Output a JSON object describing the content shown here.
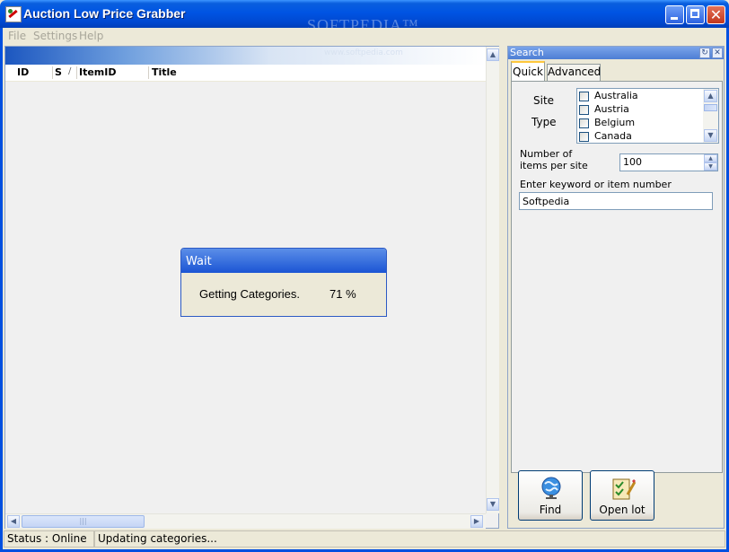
{
  "window": {
    "title": "Auction Low Price Grabber",
    "watermark": "SOFTPEDIA™"
  },
  "menu": [
    "File",
    "Settings",
    "Help"
  ],
  "list": {
    "watermark": "www.softpedia.com",
    "columns": [
      "ID",
      "S",
      "/",
      "ItemID",
      "Title"
    ],
    "hscroll_grip": "|||"
  },
  "wait_dialog": {
    "title": "Wait",
    "message": "Getting Categories.",
    "progress": "71 %"
  },
  "search": {
    "title": "Search",
    "tabs": [
      "Quick",
      "Advanced"
    ],
    "site_label": "Site",
    "type_label": "Type",
    "sites": [
      "Australia",
      "Austria",
      "Belgium",
      "Canada"
    ],
    "number_label_line1": "Number of",
    "number_label_line2": "items per site",
    "number_value": "100",
    "keyword_label": "Enter keyword or item number",
    "keyword_value": "Softpedia",
    "find_label": "Find",
    "open_lot_label": "Open lot"
  },
  "status": {
    "connection": "Status : Online",
    "message": "Updating categories..."
  },
  "icons": [
    "app-icon",
    "minimize-icon",
    "maximize-icon",
    "close-icon",
    "globe-icon",
    "checklist-icon",
    "refresh-icon"
  ]
}
